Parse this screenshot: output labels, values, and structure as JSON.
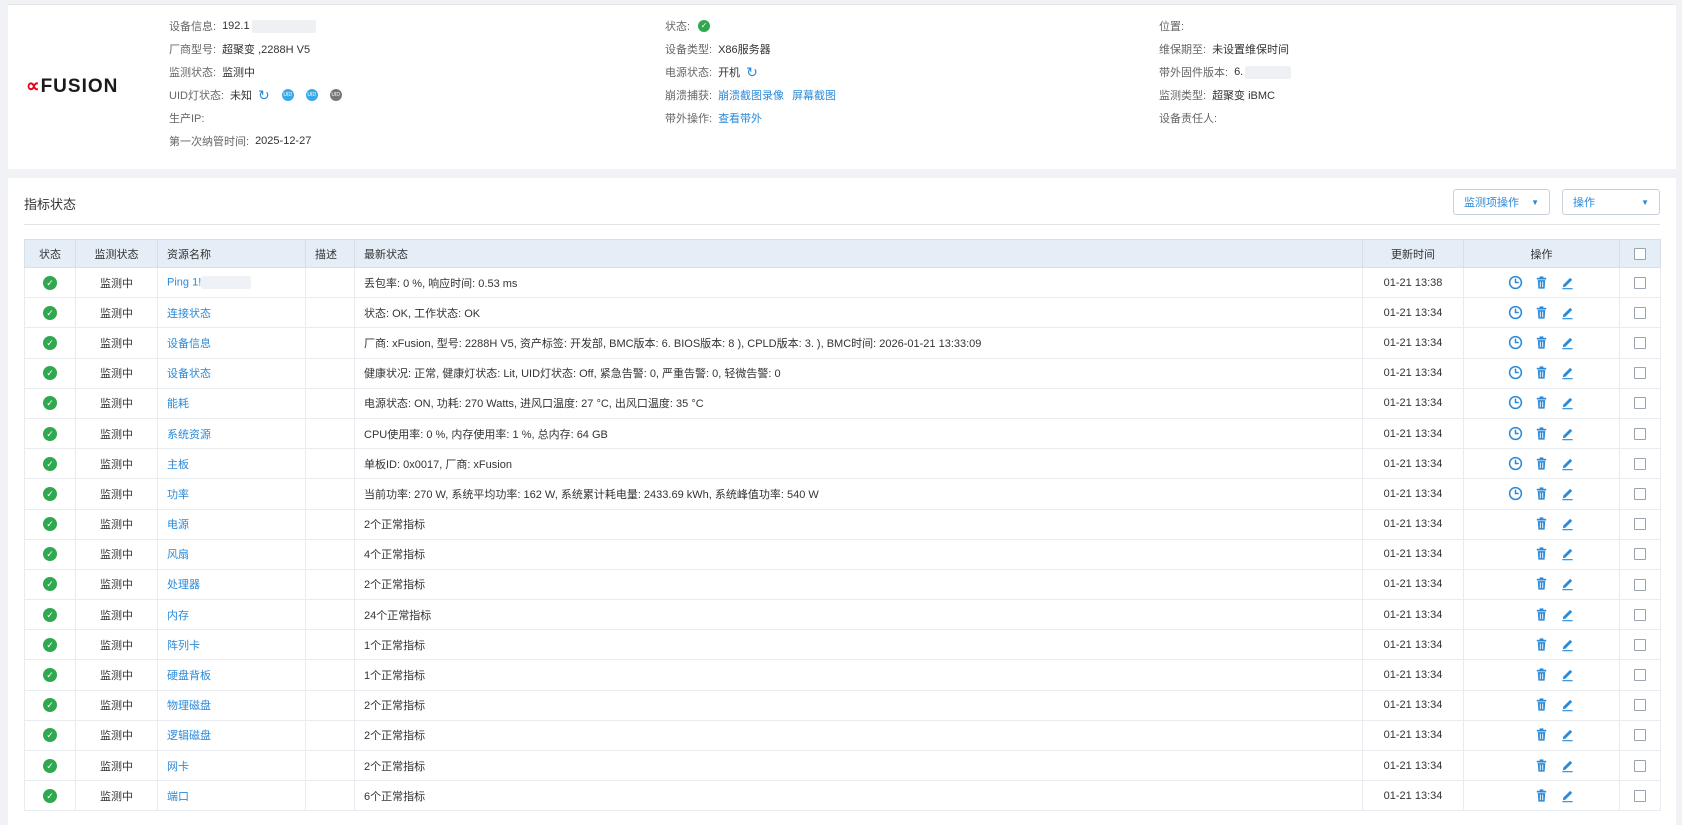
{
  "device": {
    "logo_alpha": "∝",
    "logo_text": "FUSION",
    "col1": [
      {
        "label": "设备信息:",
        "value": "192.1"
      },
      {
        "label": "厂商型号:",
        "value": "超聚变 ,2288H V5"
      },
      {
        "label": "监测状态:",
        "value": "监测中"
      },
      {
        "label": "UID灯状态:",
        "value": "未知"
      },
      {
        "label": "生产IP:",
        "value": ""
      },
      {
        "label": "第一次纳管时间:",
        "value": "2025-12-27"
      }
    ],
    "col2": [
      {
        "label": "状态:",
        "value": ""
      },
      {
        "label": "设备类型:",
        "value": "X86服务器"
      },
      {
        "label": "电源状态:",
        "value": "开机"
      },
      {
        "label": "崩溃捕获:",
        "link1": "崩溃截图录像",
        "link2": "屏幕截图"
      },
      {
        "label": "带外操作:",
        "link1": "查看带外"
      }
    ],
    "col3": [
      {
        "label": "位置:",
        "value": ""
      },
      {
        "label": "维保期至:",
        "value": "未设置维保时间"
      },
      {
        "label": "带外固件版本:",
        "value": "6."
      },
      {
        "label": "监测类型:",
        "value": "超聚变 iBMC"
      },
      {
        "label": "设备责任人:",
        "value": ""
      }
    ],
    "uid_badge_text": "UID"
  },
  "metrics": {
    "title": "指标状态",
    "btn_monitor_ops": "监测项操作",
    "btn_ops": "操作",
    "headers": {
      "status": "状态",
      "monitor_status": "监测状态",
      "resource": "资源名称",
      "desc": "描述",
      "latest": "最新状态",
      "updated": "更新时间",
      "ops": "操作"
    },
    "rows": [
      {
        "monitor": "监测中",
        "name": "Ping 1!",
        "latest": "丢包率: 0 %, 响应时间: 0.53 ms",
        "time": "01-21 13:38",
        "green": false,
        "history": true
      },
      {
        "monitor": "监测中",
        "name": "连接状态",
        "latest": "状态: OK, 工作状态: OK",
        "time": "01-21 13:34",
        "green": false,
        "history": true
      },
      {
        "monitor": "监测中",
        "name": "设备信息",
        "latest": "厂商: xFusion, 型号: 2288H V5, 资产标签: 开发部, BMC版本: 6.          BIOS版本: 8         ), CPLD版本: 3.          ), BMC时间: 2026-01-21 13:33:09",
        "time": "01-21 13:34",
        "green": false,
        "history": true
      },
      {
        "monitor": "监测中",
        "name": "设备状态",
        "latest": "健康状况: 正常, 健康灯状态: Lit, UID灯状态: Off, 紧急告警: 0, 严重告警: 0, 轻微告警: 0",
        "time": "01-21 13:34",
        "green": false,
        "history": true
      },
      {
        "monitor": "监测中",
        "name": "能耗",
        "latest": "电源状态: ON, 功耗: 270 Watts, 进风口温度: 27 °C, 出风口温度: 35 °C",
        "time": "01-21 13:34",
        "green": false,
        "history": true
      },
      {
        "monitor": "监测中",
        "name": "系统资源",
        "latest": "CPU使用率: 0 %, 内存使用率: 1 %, 总内存: 64 GB",
        "time": "01-21 13:34",
        "green": false,
        "history": true
      },
      {
        "monitor": "监测中",
        "name": "主板",
        "latest": "单板ID: 0x0017, 厂商: xFusion",
        "time": "01-21 13:34",
        "green": false,
        "history": true
      },
      {
        "monitor": "监测中",
        "name": "功率",
        "latest": "当前功率: 270 W, 系统平均功率: 162 W, 系统累计耗电量: 2433.69 kWh, 系统峰值功率: 540 W",
        "time": "01-21 13:34",
        "green": false,
        "history": true
      },
      {
        "monitor": "监测中",
        "name": "电源",
        "latest": "2个正常指标",
        "time": "01-21 13:34",
        "green": true,
        "history": false
      },
      {
        "monitor": "监测中",
        "name": "风扇",
        "latest": "4个正常指标",
        "time": "01-21 13:34",
        "green": true,
        "history": false
      },
      {
        "monitor": "监测中",
        "name": "处理器",
        "latest": "2个正常指标",
        "time": "01-21 13:34",
        "green": true,
        "history": false
      },
      {
        "monitor": "监测中",
        "name": "内存",
        "latest": "24个正常指标",
        "time": "01-21 13:34",
        "green": true,
        "history": false
      },
      {
        "monitor": "监测中",
        "name": "阵列卡",
        "latest": "1个正常指标",
        "time": "01-21 13:34",
        "green": true,
        "history": false
      },
      {
        "monitor": "监测中",
        "name": "硬盘背板",
        "latest": "1个正常指标",
        "time": "01-21 13:34",
        "green": true,
        "history": false
      },
      {
        "monitor": "监测中",
        "name": "物理磁盘",
        "latest": "2个正常指标",
        "time": "01-21 13:34",
        "green": true,
        "history": false
      },
      {
        "monitor": "监测中",
        "name": "逻辑磁盘",
        "latest": "2个正常指标",
        "time": "01-21 13:34",
        "green": true,
        "history": false
      },
      {
        "monitor": "监测中",
        "name": "网卡",
        "latest": "2个正常指标",
        "time": "01-21 13:34",
        "green": true,
        "history": false
      },
      {
        "monitor": "监测中",
        "name": "端口",
        "latest": "6个正常指标",
        "time": "01-21 13:34",
        "green": true,
        "history": false
      }
    ]
  },
  "colors": {
    "link": "#2b8ad8",
    "ok": "#2fa84f",
    "green_text": "#2e9e45",
    "header_bg": "#e5eef7"
  }
}
